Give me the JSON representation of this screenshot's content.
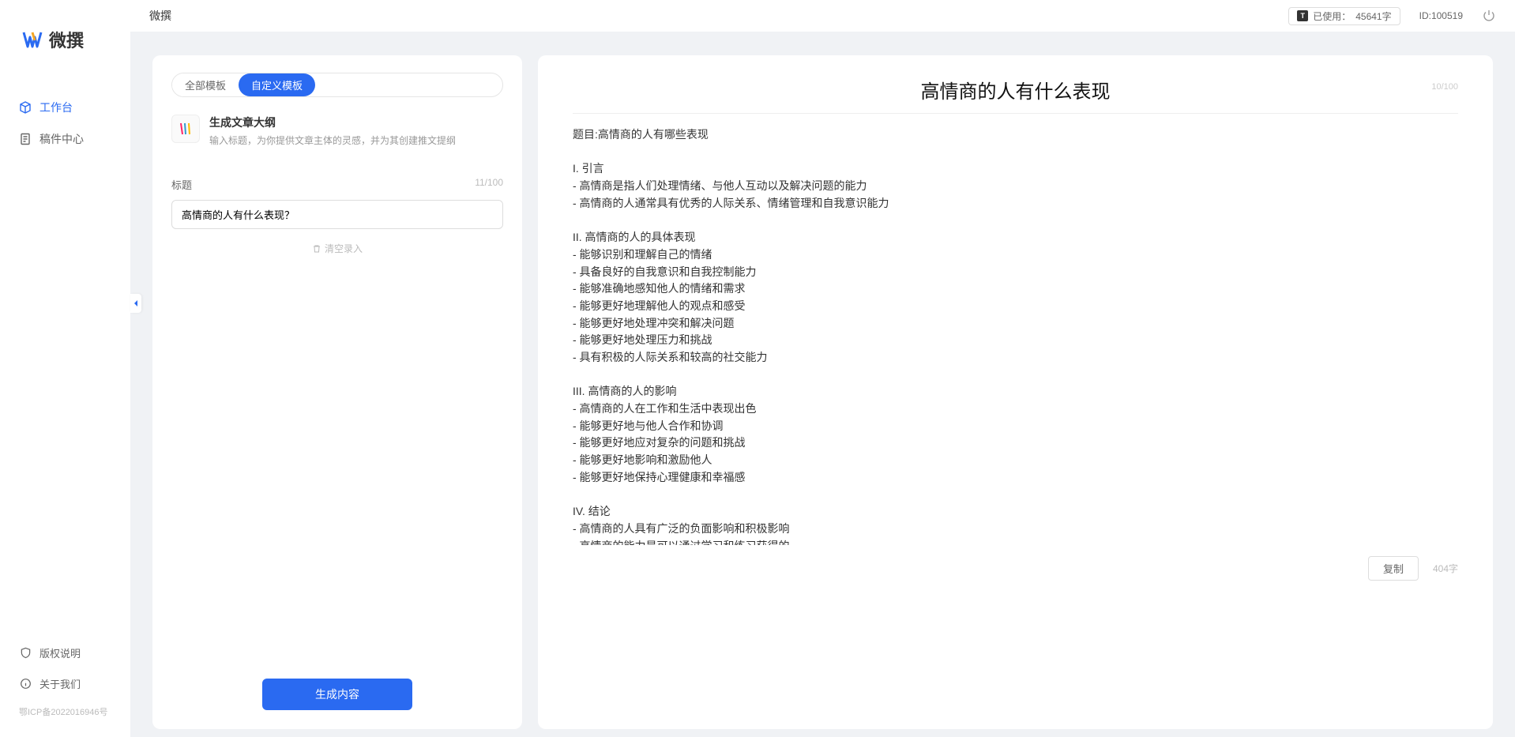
{
  "app": {
    "name": "微撰",
    "icp": "鄂ICP备2022016946号"
  },
  "topbar": {
    "title": "微撰",
    "usage_label": "已使用：",
    "usage_value": "45641字",
    "id_label": "ID:100519"
  },
  "sidebar": {
    "nav": [
      {
        "label": "工作台",
        "active": true,
        "icon": "cube"
      },
      {
        "label": "稿件中心",
        "active": false,
        "icon": "doc"
      }
    ],
    "bottom": [
      {
        "label": "版权说明",
        "icon": "shield"
      },
      {
        "label": "关于我们",
        "icon": "info"
      }
    ]
  },
  "left": {
    "tabs": [
      {
        "label": "全部模板",
        "active": false
      },
      {
        "label": "自定义模板",
        "active": true
      }
    ],
    "template": {
      "title": "生成文章大纲",
      "desc": "输入标题，为你提供文章主体的灵感，并为其创建推文提纲"
    },
    "form": {
      "label": "标题",
      "char_count": "11/100",
      "value": "高情商的人有什么表现？",
      "clear_label": "清空录入"
    },
    "generate_label": "生成内容"
  },
  "output": {
    "title": "高情商的人有什么表现",
    "title_count": "10/100",
    "body": "题目:高情商的人有哪些表现\n\nI. 引言\n- 高情商是指人们处理情绪、与他人互动以及解决问题的能力\n- 高情商的人通常具有优秀的人际关系、情绪管理和自我意识能力\n\nII. 高情商的人的具体表现\n- 能够识别和理解自己的情绪\n- 具备良好的自我意识和自我控制能力\n- 能够准确地感知他人的情绪和需求\n- 能够更好地理解他人的观点和感受\n- 能够更好地处理冲突和解决问题\n- 能够更好地处理压力和挑战\n- 具有积极的人际关系和较高的社交能力\n\nIII. 高情商的人的影响\n- 高情商的人在工作和生活中表现出色\n- 能够更好地与他人合作和协调\n- 能够更好地应对复杂的问题和挑战\n- 能够更好地影响和激励他人\n- 能够更好地保持心理健康和幸福感\n\nIV. 结论\n- 高情商的人具有广泛的负面影响和积极影响\n- 高情商的能力是可以通过学习和练习获得的\n- 培养和提高高情商的能力对于个人的职业发展和生活质量至关重要。",
    "copy_label": "复制",
    "word_count": "404字"
  }
}
